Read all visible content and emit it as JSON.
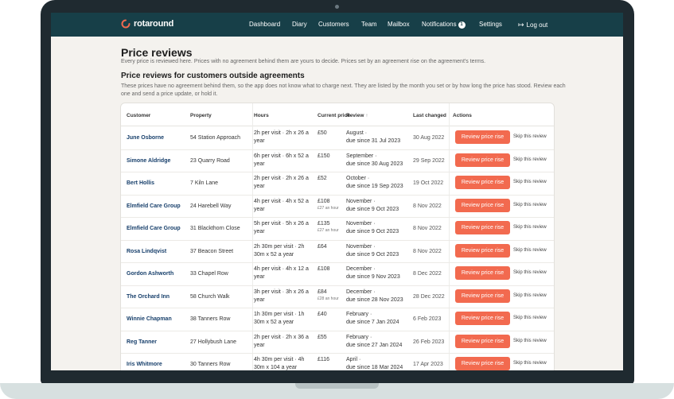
{
  "app": {
    "brand": "rotaround",
    "accent": "#f26a4f",
    "nav_bg": "#173f48"
  },
  "nav": {
    "items": [
      "Dashboard",
      "Diary",
      "Customers",
      "Team",
      "Mailbox",
      "Notifications",
      "Settings"
    ],
    "notifications_badge": "1",
    "logout": "Log out"
  },
  "page": {
    "title": "Price reviews",
    "description": "Every price is reviewed here. Prices with no agreement behind them are yours to decide. Prices set by an agreement rise on the agreement's terms."
  },
  "section": {
    "title": "Price reviews for customers outside agreements",
    "description": "These prices have no agreement behind them, so the app does not know what to charge next. They are listed by the month you set or by how long the price has stood. Review each one and send a price update, or hold it."
  },
  "table": {
    "headers": {
      "customer": "Customer",
      "property": "Property",
      "hours": "Hours",
      "current_price": "Current price",
      "review": "Review",
      "last_changed": "Last changed",
      "actions": "Actions"
    },
    "review_button": "Review price rise",
    "skip_link": "Skip this review",
    "rows": [
      {
        "customer": "June Osborne",
        "property": "54 Station Approach",
        "hours1": "2h per visit · 2h x 26 a",
        "hours2": "year",
        "price": "£50",
        "price_sub": "",
        "review1": "August ·",
        "review2": "due since 31 Jul 2023",
        "changed": "30 Aug 2022"
      },
      {
        "customer": "Simone Aldridge",
        "property": "23 Quarry Road",
        "hours1": "6h per visit · 6h x 52 a",
        "hours2": "year",
        "price": "£150",
        "price_sub": "",
        "review1": "September ·",
        "review2": "due since 30 Aug 2023",
        "changed": "29 Sep 2022"
      },
      {
        "customer": "Bert Hollis",
        "property": "7 Kiln Lane",
        "hours1": "2h per visit · 2h x 26 a",
        "hours2": "year",
        "price": "£52",
        "price_sub": "",
        "review1": "October ·",
        "review2": "due since 19 Sep 2023",
        "changed": "19 Oct 2022"
      },
      {
        "customer": "Elmfield Care Group",
        "property": "24 Harebell Way",
        "hours1": "4h per visit · 4h x 52 a",
        "hours2": "year",
        "price": "£108",
        "price_sub": "£27 an hour",
        "review1": "November ·",
        "review2": "due since 9 Oct 2023",
        "changed": "8 Nov 2022"
      },
      {
        "customer": "Elmfield Care Group",
        "property": "31 Blackthorn Close",
        "hours1": "5h per visit · 5h x 26 a",
        "hours2": "year",
        "price": "£135",
        "price_sub": "£27 an hour",
        "review1": "November ·",
        "review2": "due since 9 Oct 2023",
        "changed": "8 Nov 2022"
      },
      {
        "customer": "Rosa Lindqvist",
        "property": "37 Beacon Street",
        "hours1": "2h 30m per visit · 2h",
        "hours2": "30m x 52 a year",
        "price": "£64",
        "price_sub": "",
        "review1": "November ·",
        "review2": "due since 9 Oct 2023",
        "changed": "8 Nov 2022"
      },
      {
        "customer": "Gordon Ashworth",
        "property": "33 Chapel Row",
        "hours1": "4h per visit · 4h x 12 a",
        "hours2": "year",
        "price": "£108",
        "price_sub": "",
        "review1": "December ·",
        "review2": "due since 9 Nov 2023",
        "changed": "8 Dec 2022"
      },
      {
        "customer": "The Orchard Inn",
        "property": "58 Church Walk",
        "hours1": "3h per visit · 3h x 26 a",
        "hours2": "year",
        "price": "£84",
        "price_sub": "£28 an hour",
        "review1": "December ·",
        "review2": "due since 28 Nov 2023",
        "changed": "28 Dec 2022"
      },
      {
        "customer": "Winnie Chapman",
        "property": "38 Tanners Row",
        "hours1": "1h 30m per visit · 1h",
        "hours2": "30m x 52 a year",
        "price": "£40",
        "price_sub": "",
        "review1": "February ·",
        "review2": "due since 7 Jan 2024",
        "changed": "6 Feb 2023"
      },
      {
        "customer": "Reg Tanner",
        "property": "27 Hollybush Lane",
        "hours1": "2h per visit · 2h x 36 a",
        "hours2": "year",
        "price": "£55",
        "price_sub": "",
        "review1": "February ·",
        "review2": "due since 27 Jan 2024",
        "changed": "26 Feb 2023"
      },
      {
        "customer": "Iris Whitmore",
        "property": "30 Tanners Row",
        "hours1": "4h 30m per visit · 4h",
        "hours2": "30m x 104 a year",
        "price": "£116",
        "price_sub": "",
        "review1": "April ·",
        "review2": "due since 18 Mar 2024",
        "changed": "17 Apr 2023"
      }
    ]
  }
}
